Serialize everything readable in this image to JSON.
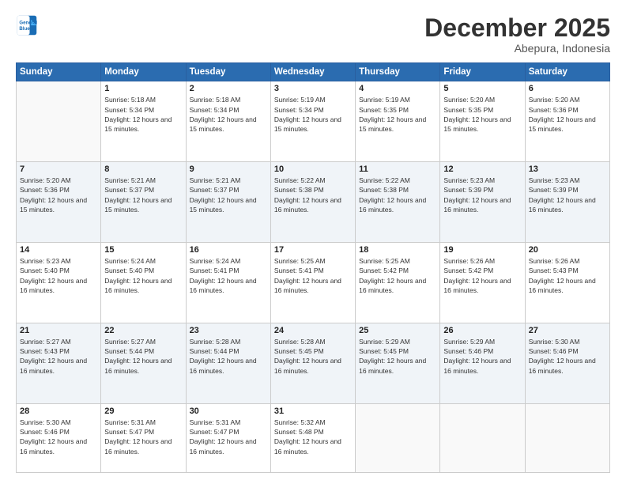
{
  "logo": {
    "line1": "General",
    "line2": "Blue"
  },
  "header": {
    "month": "December 2025",
    "location": "Abepura, Indonesia"
  },
  "weekdays": [
    "Sunday",
    "Monday",
    "Tuesday",
    "Wednesday",
    "Thursday",
    "Friday",
    "Saturday"
  ],
  "weeks": [
    [
      {
        "day": "",
        "sunrise": "",
        "sunset": "",
        "daylight": ""
      },
      {
        "day": "1",
        "sunrise": "Sunrise: 5:18 AM",
        "sunset": "Sunset: 5:34 PM",
        "daylight": "Daylight: 12 hours and 15 minutes."
      },
      {
        "day": "2",
        "sunrise": "Sunrise: 5:18 AM",
        "sunset": "Sunset: 5:34 PM",
        "daylight": "Daylight: 12 hours and 15 minutes."
      },
      {
        "day": "3",
        "sunrise": "Sunrise: 5:19 AM",
        "sunset": "Sunset: 5:34 PM",
        "daylight": "Daylight: 12 hours and 15 minutes."
      },
      {
        "day": "4",
        "sunrise": "Sunrise: 5:19 AM",
        "sunset": "Sunset: 5:35 PM",
        "daylight": "Daylight: 12 hours and 15 minutes."
      },
      {
        "day": "5",
        "sunrise": "Sunrise: 5:20 AM",
        "sunset": "Sunset: 5:35 PM",
        "daylight": "Daylight: 12 hours and 15 minutes."
      },
      {
        "day": "6",
        "sunrise": "Sunrise: 5:20 AM",
        "sunset": "Sunset: 5:36 PM",
        "daylight": "Daylight: 12 hours and 15 minutes."
      }
    ],
    [
      {
        "day": "7",
        "sunrise": "Sunrise: 5:20 AM",
        "sunset": "Sunset: 5:36 PM",
        "daylight": "Daylight: 12 hours and 15 minutes."
      },
      {
        "day": "8",
        "sunrise": "Sunrise: 5:21 AM",
        "sunset": "Sunset: 5:37 PM",
        "daylight": "Daylight: 12 hours and 15 minutes."
      },
      {
        "day": "9",
        "sunrise": "Sunrise: 5:21 AM",
        "sunset": "Sunset: 5:37 PM",
        "daylight": "Daylight: 12 hours and 15 minutes."
      },
      {
        "day": "10",
        "sunrise": "Sunrise: 5:22 AM",
        "sunset": "Sunset: 5:38 PM",
        "daylight": "Daylight: 12 hours and 16 minutes."
      },
      {
        "day": "11",
        "sunrise": "Sunrise: 5:22 AM",
        "sunset": "Sunset: 5:38 PM",
        "daylight": "Daylight: 12 hours and 16 minutes."
      },
      {
        "day": "12",
        "sunrise": "Sunrise: 5:23 AM",
        "sunset": "Sunset: 5:39 PM",
        "daylight": "Daylight: 12 hours and 16 minutes."
      },
      {
        "day": "13",
        "sunrise": "Sunrise: 5:23 AM",
        "sunset": "Sunset: 5:39 PM",
        "daylight": "Daylight: 12 hours and 16 minutes."
      }
    ],
    [
      {
        "day": "14",
        "sunrise": "Sunrise: 5:23 AM",
        "sunset": "Sunset: 5:40 PM",
        "daylight": "Daylight: 12 hours and 16 minutes."
      },
      {
        "day": "15",
        "sunrise": "Sunrise: 5:24 AM",
        "sunset": "Sunset: 5:40 PM",
        "daylight": "Daylight: 12 hours and 16 minutes."
      },
      {
        "day": "16",
        "sunrise": "Sunrise: 5:24 AM",
        "sunset": "Sunset: 5:41 PM",
        "daylight": "Daylight: 12 hours and 16 minutes."
      },
      {
        "day": "17",
        "sunrise": "Sunrise: 5:25 AM",
        "sunset": "Sunset: 5:41 PM",
        "daylight": "Daylight: 12 hours and 16 minutes."
      },
      {
        "day": "18",
        "sunrise": "Sunrise: 5:25 AM",
        "sunset": "Sunset: 5:42 PM",
        "daylight": "Daylight: 12 hours and 16 minutes."
      },
      {
        "day": "19",
        "sunrise": "Sunrise: 5:26 AM",
        "sunset": "Sunset: 5:42 PM",
        "daylight": "Daylight: 12 hours and 16 minutes."
      },
      {
        "day": "20",
        "sunrise": "Sunrise: 5:26 AM",
        "sunset": "Sunset: 5:43 PM",
        "daylight": "Daylight: 12 hours and 16 minutes."
      }
    ],
    [
      {
        "day": "21",
        "sunrise": "Sunrise: 5:27 AM",
        "sunset": "Sunset: 5:43 PM",
        "daylight": "Daylight: 12 hours and 16 minutes."
      },
      {
        "day": "22",
        "sunrise": "Sunrise: 5:27 AM",
        "sunset": "Sunset: 5:44 PM",
        "daylight": "Daylight: 12 hours and 16 minutes."
      },
      {
        "day": "23",
        "sunrise": "Sunrise: 5:28 AM",
        "sunset": "Sunset: 5:44 PM",
        "daylight": "Daylight: 12 hours and 16 minutes."
      },
      {
        "day": "24",
        "sunrise": "Sunrise: 5:28 AM",
        "sunset": "Sunset: 5:45 PM",
        "daylight": "Daylight: 12 hours and 16 minutes."
      },
      {
        "day": "25",
        "sunrise": "Sunrise: 5:29 AM",
        "sunset": "Sunset: 5:45 PM",
        "daylight": "Daylight: 12 hours and 16 minutes."
      },
      {
        "day": "26",
        "sunrise": "Sunrise: 5:29 AM",
        "sunset": "Sunset: 5:46 PM",
        "daylight": "Daylight: 12 hours and 16 minutes."
      },
      {
        "day": "27",
        "sunrise": "Sunrise: 5:30 AM",
        "sunset": "Sunset: 5:46 PM",
        "daylight": "Daylight: 12 hours and 16 minutes."
      }
    ],
    [
      {
        "day": "28",
        "sunrise": "Sunrise: 5:30 AM",
        "sunset": "Sunset: 5:46 PM",
        "daylight": "Daylight: 12 hours and 16 minutes."
      },
      {
        "day": "29",
        "sunrise": "Sunrise: 5:31 AM",
        "sunset": "Sunset: 5:47 PM",
        "daylight": "Daylight: 12 hours and 16 minutes."
      },
      {
        "day": "30",
        "sunrise": "Sunrise: 5:31 AM",
        "sunset": "Sunset: 5:47 PM",
        "daylight": "Daylight: 12 hours and 16 minutes."
      },
      {
        "day": "31",
        "sunrise": "Sunrise: 5:32 AM",
        "sunset": "Sunset: 5:48 PM",
        "daylight": "Daylight: 12 hours and 16 minutes."
      },
      {
        "day": "",
        "sunrise": "",
        "sunset": "",
        "daylight": ""
      },
      {
        "day": "",
        "sunrise": "",
        "sunset": "",
        "daylight": ""
      },
      {
        "day": "",
        "sunrise": "",
        "sunset": "",
        "daylight": ""
      }
    ]
  ]
}
